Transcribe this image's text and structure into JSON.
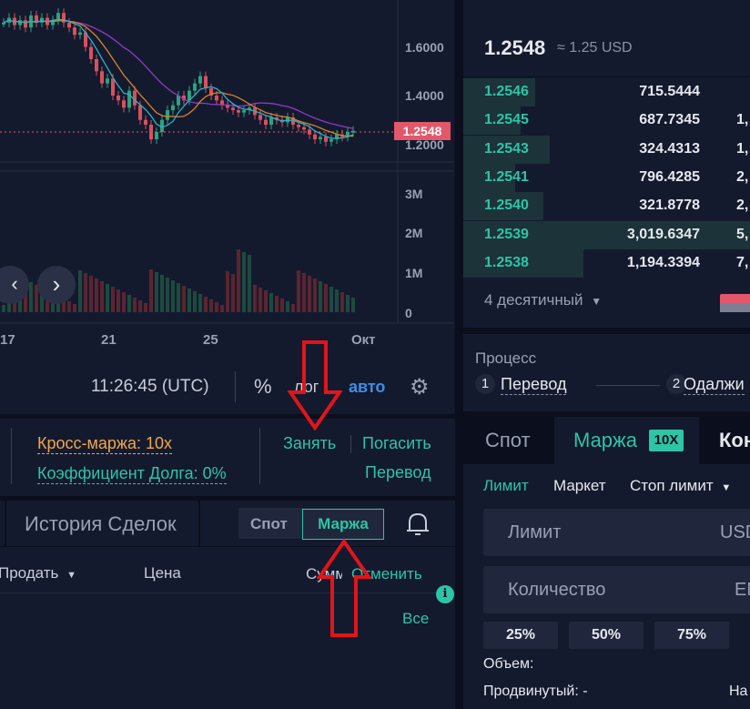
{
  "chart": {
    "y_ticks": [
      "1.6000",
      "1.4000",
      "1.2000"
    ],
    "current_price": "1.2548",
    "vol_ticks": [
      "3M",
      "2M",
      "1M",
      "0"
    ],
    "x_ticks": [
      "17",
      "21",
      "25",
      "Окт"
    ],
    "time": "11:26:45 (UTC)",
    "percent_label": "%",
    "log_label": "лог",
    "auto_label": "авто",
    "colors": {
      "up": "#2ea27e",
      "down": "#d8505e",
      "ma_purple": "#8e3bc6",
      "ma_orange": "#d9822b",
      "ma_teal": "#2ab3c8"
    }
  },
  "orderbook": {
    "last_price": "1.2548",
    "last_price_usd": "≈ 1.25 USD",
    "rows": [
      {
        "price": "1.2546",
        "amount": "715.5444",
        "total": ""
      },
      {
        "price": "1.2545",
        "amount": "687.7345",
        "total": "1,"
      },
      {
        "price": "1.2543",
        "amount": "324.4313",
        "total": "1,"
      },
      {
        "price": "1.2541",
        "amount": "796.4285",
        "total": "2,"
      },
      {
        "price": "1.2540",
        "amount": "321.8778",
        "total": "2,"
      },
      {
        "price": "1.2539",
        "amount": "3,019.6347",
        "total": "5,"
      },
      {
        "price": "1.2538",
        "amount": "1,194.3394",
        "total": "7,"
      }
    ],
    "depth_fractions": [
      0.25,
      0.2,
      0.3,
      0.18,
      0.28,
      1.0,
      0.42
    ],
    "decimals_label": "4 десятичный"
  },
  "process": {
    "title": "Процесс",
    "step1_num": "1",
    "step1": "Перевод",
    "step2_num": "2",
    "step2": "Одалжи"
  },
  "margin": {
    "cross_margin": "Кросс-маржа: 10x",
    "debt_ratio": "Коэффициент Долга: 0%",
    "borrow": "Занять",
    "repay": "Погасить",
    "transfer": "Перевод"
  },
  "history": {
    "tab_title": "История Сделок",
    "spot": "Спот",
    "margin": "Маржа",
    "col_sell": "Продать",
    "col_price": "Цена",
    "col_sum": "Сумм",
    "col_cancel": "Отменить",
    "all": "Все",
    "info": "i"
  },
  "trade": {
    "tab_spot": "Спот",
    "tab_margin": "Маржа",
    "badge": "10X",
    "tab_cut": "Кон",
    "limit": "Лимит",
    "market": "Маркет",
    "stop_limit": "Стоп лимит",
    "limit_input": "Лимит",
    "limit_unit": "USD",
    "qty_input": "Количество",
    "qty_unit": "EN",
    "pct": [
      "25%",
      "50%",
      "75%"
    ],
    "volume": "Объем:",
    "advanced": "Продвинутый: -",
    "cut_right": "На"
  }
}
